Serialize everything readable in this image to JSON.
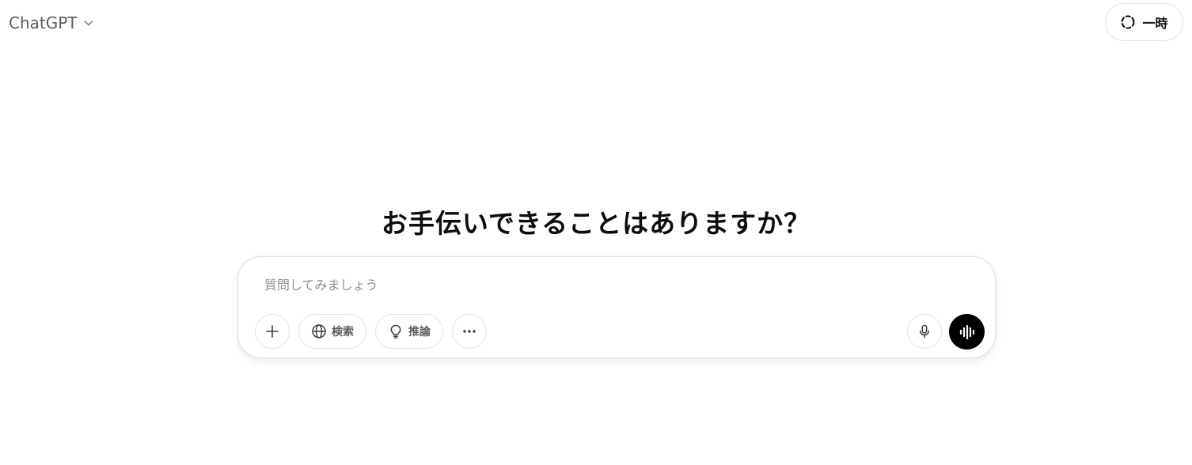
{
  "header": {
    "model_name": "ChatGPT",
    "temporary_label": "一時"
  },
  "main": {
    "headline": "お手伝いできることはありますか？"
  },
  "composer": {
    "placeholder": "質問してみましょう",
    "search_label": "検索",
    "reason_label": "推論"
  },
  "icons": {
    "model_switcher": "chevron-down-icon",
    "temporary": "dashed-circle-icon",
    "plus": "plus-icon",
    "search": "globe-icon",
    "reason": "lightbulb-icon",
    "more": "more-dots-icon",
    "mic": "microphone-icon",
    "voice": "voice-waveform-icon"
  }
}
